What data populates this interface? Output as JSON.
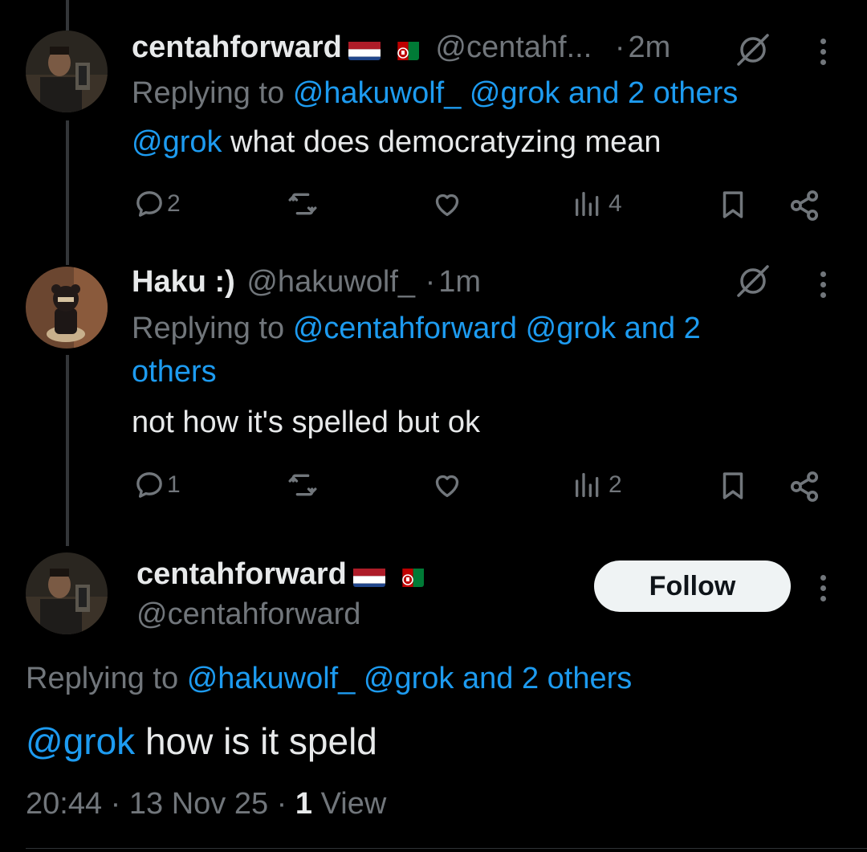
{
  "tweet1": {
    "display_name": "centahforward",
    "handle": "@centahf...",
    "sep": "·",
    "time": "2m",
    "replying_prefix": "Replying to",
    "replying_mentions": "@hakuwolf_ @grok and 2 others",
    "mention": "@grok",
    "body": " what does democratyzing mean",
    "replies": "2",
    "views": "4"
  },
  "tweet2": {
    "display_name": "Haku :)",
    "handle": "@hakuwolf_",
    "sep": "·",
    "time": "1m",
    "replying_prefix": "Replying to",
    "replying_line1": "@centahforward @grok and 2",
    "replying_line2": "others",
    "body": "not how it's spelled but ok",
    "replies": "1",
    "views": "2"
  },
  "main_tweet": {
    "display_name": "centahforward",
    "handle": "@centahforward",
    "follow_label": "Follow",
    "replying_prefix": "Replying to",
    "replying_mentions": "@hakuwolf_ @grok and 2 others",
    "mention": "@grok",
    "body": " how is it speld",
    "time": "20:44",
    "sep1": "·",
    "date": "13 Nov 25",
    "sep2": "·",
    "views_count": "1",
    "views_label": "View"
  },
  "colors": {
    "background": "#000000",
    "text": "#e7e9ea",
    "secondary": "#71767b",
    "link": "#1d9bf0",
    "follow_bg": "#eff3f4"
  },
  "icons": [
    "grok-icon",
    "more-icon",
    "reply-icon",
    "repost-icon",
    "like-icon",
    "views-icon",
    "bookmark-icon",
    "share-icon",
    "netherlands-flag-icon",
    "afghanistan-flag-icon"
  ]
}
